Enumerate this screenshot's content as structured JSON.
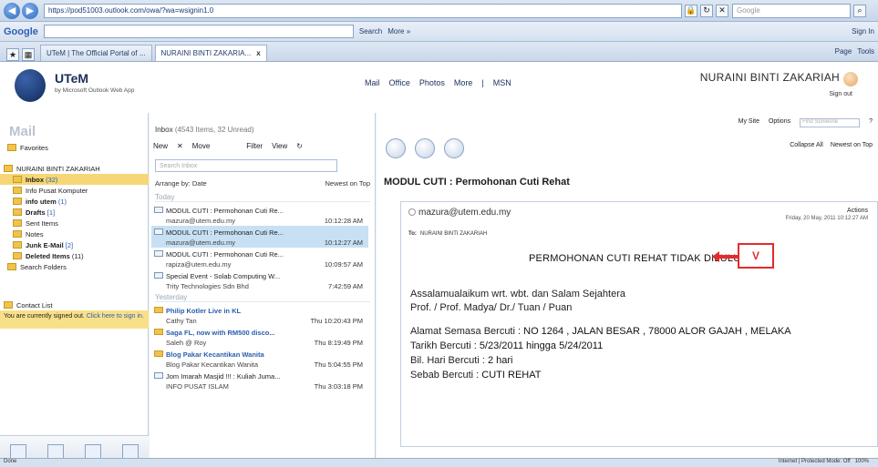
{
  "browser": {
    "url": "https://pod51003.outlook.com/owa/?wa=wsignin1.0",
    "search_placeholder": "Google",
    "google_logo": "Google",
    "google_search_label": "Search",
    "google_more_label": "More »",
    "signin_label": "Sign In",
    "tabs": [
      {
        "label": "UTeM | The Official Portal of ..."
      },
      {
        "label": "NURAINI BINTI ZAKARIA..."
      }
    ],
    "tab_close": "x",
    "tools": [
      "Page",
      "Tools"
    ],
    "status_zone": "Internet | Protected Mode: Off",
    "zoom": "100%",
    "status_left": "Done"
  },
  "owa": {
    "logo_title": "UTeM",
    "logo_sub": "by Microsoft Outlook Web App",
    "topnav": [
      "Mail",
      "Office",
      "Photos",
      "More",
      "|",
      "MSN"
    ],
    "user_name": "NURAINI BINTI ZAKARIAH",
    "sign_out": "Sign out",
    "my_site": "My Site",
    "options": "Options",
    "find_someone": "Find Someone"
  },
  "leftnav": {
    "title": "Mail",
    "favorites": "Favorites",
    "mailbox": "NURAINI BINTI ZAKARIAH",
    "folders": [
      {
        "label": "Inbox",
        "count": "(32)"
      },
      {
        "label": "Info Pusat Komputer",
        "count": ""
      },
      {
        "label": "info utem",
        "count": "(1)"
      },
      {
        "label": "Drafts",
        "count": "[1]"
      },
      {
        "label": "Sent Items",
        "count": ""
      },
      {
        "label": "Notes",
        "count": ""
      },
      {
        "label": "Junk E-Mail",
        "count": "[2]"
      },
      {
        "label": "Deleted Items",
        "count": "(11)"
      },
      {
        "label": "Search Folders",
        "count": ""
      }
    ],
    "contact_list": "Contact List",
    "signed_out_text": "You are currently signed out.",
    "signed_out_link": "Click here to sign in."
  },
  "list": {
    "inbox_label": "Inbox",
    "inbox_count": "(4543 Items, 32 Unread)",
    "toolbar": [
      "New",
      "Move",
      "Filter",
      "View"
    ],
    "search_placeholder": "Search Inbox",
    "arrange_by": "Arrange by: Date",
    "sort_order": "Newest on Top",
    "group_today": "Today",
    "group_yesterday": "Yesterday",
    "messages": [
      {
        "subject": "MODUL CUTI : Permohonan Cuti Re...",
        "sender": "mazura@utem.edu.my",
        "time": "10:12:28 AM"
      },
      {
        "subject": "MODUL CUTI : Permohonan Cuti Re...",
        "sender": "mazura@utem.edu.my",
        "time": "10:12:27 AM"
      },
      {
        "subject": "MODUL CUTI : Permohonan Cuti Re...",
        "sender": "rapiza@utem.edu.my",
        "time": "10:09:57 AM"
      },
      {
        "subject": "Special Event - Solab Computing W...",
        "sender": "Trity Technologies Sdn Bhd",
        "time": "7:42:59 AM"
      },
      {
        "subject": "Philip Kotler Live in KL",
        "sender": "Cathy Tan",
        "time": "Thu 10:20:43 PM"
      },
      {
        "subject": "Saga FL, now with RM500 disco...",
        "sender": "Saleh @ Roy",
        "time": "Thu 8:19:49 PM"
      },
      {
        "subject": "Blog Pakar Kecantikan Wanita",
        "sender": "Blog Pakar Kecantikan Wanita",
        "time": "Thu 5:04:55 PM"
      },
      {
        "subject": "Jom Imarah Masjid !!! : Kuliah Juma...",
        "sender": "INFO PUSAT ISLAM",
        "time": "Thu 3:03:18 PM"
      }
    ]
  },
  "reading": {
    "collapse_all": "Collapse All",
    "newest_on_top": "Newest on Top",
    "subject": "MODUL CUTI : Permohonan Cuti Rehat",
    "from": "mazura@utem.edu.my",
    "actions": "Actions",
    "sent": "Friday, 20 May, 2011 10:12:27 AM",
    "to_label": "To:",
    "to_value": "NURAINI BINTI ZAKARIAH",
    "banner": "PERMOHONAN CUTI REHAT TIDAK DILULUS",
    "stamp": "V",
    "greeting": "Assalamualaikum wrt. wbt. dan Salam Sejahtera",
    "salutation": "Prof. / Prof. Madya/ Dr./ Tuan / Puan",
    "address_label": "Alamat Semasa Bercuti :",
    "address_value": "NO 1264 , JALAN BESAR , 78000 ALOR GAJAH , MELAKA",
    "dates_label": "Tarikh Bercuti :",
    "dates_value": "5/23/2011 hingga 5/24/2011",
    "days_label": "Bil. Hari Bercuti :",
    "days_value": "2 hari",
    "reason_label": "Sebab Bercuti :",
    "reason_value": "CUTI REHAT"
  },
  "colors": {
    "accent": "#2a5db0",
    "selected": "#c7e0f4",
    "warning": "#e42b2b",
    "folder_sel": "#f6d676"
  }
}
